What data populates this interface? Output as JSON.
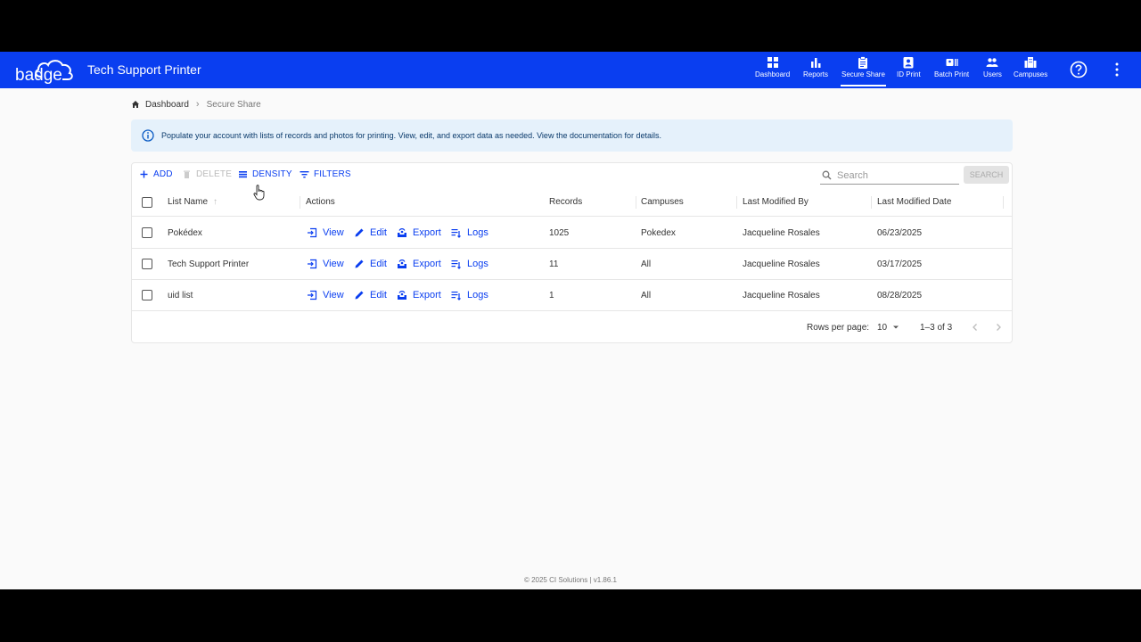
{
  "appbar": {
    "logo_text": "badge",
    "title": "Tech Support Printer",
    "nav": [
      {
        "label": "Dashboard",
        "icon": "dashboard-icon"
      },
      {
        "label": "Reports",
        "icon": "bar-chart-icon"
      },
      {
        "label": "Secure Share",
        "icon": "clipboard-icon",
        "active": true
      },
      {
        "label": "ID Print",
        "icon": "id-badge-icon"
      },
      {
        "label": "Batch Print",
        "icon": "batch-print-icon"
      },
      {
        "label": "Users",
        "icon": "users-icon"
      },
      {
        "label": "Campuses",
        "icon": "building-icon"
      }
    ]
  },
  "breadcrumb": {
    "home": "Dashboard",
    "current": "Secure Share"
  },
  "info": {
    "text": "Populate your account with lists of records and photos for printing. View, edit, and export data as needed. View the documentation for details."
  },
  "toolbar": {
    "add": "ADD",
    "delete": "DELETE",
    "density": "DENSITY",
    "filters": "FILTERS",
    "search_placeholder": "Search",
    "search_button": "SEARCH"
  },
  "table": {
    "columns": [
      "List Name",
      "Actions",
      "Records",
      "Campuses",
      "Last Modified By",
      "Last Modified Date"
    ],
    "actions": [
      "View",
      "Edit",
      "Export",
      "Logs"
    ],
    "rows": [
      {
        "name": "Pokédex",
        "records": "1025",
        "campuses": "Pokedex",
        "modified_by": "Jacqueline Rosales",
        "modified_date": "06/23/2025"
      },
      {
        "name": "Tech Support Printer",
        "records": "11",
        "campuses": "All",
        "modified_by": "Jacqueline Rosales",
        "modified_date": "03/17/2025"
      },
      {
        "name": "uid list",
        "records": "1",
        "campuses": "All",
        "modified_by": "Jacqueline Rosales",
        "modified_date": "08/28/2025"
      }
    ]
  },
  "pagination": {
    "rows_per_page_label": "Rows per page:",
    "rows_per_page_value": "10",
    "range": "1–3 of 3"
  },
  "footer": {
    "copyright": "© 2025 CI Solutions | v1.86.1"
  },
  "colors": {
    "primary": "#0a3ef0",
    "info_bg": "#e5f1fb"
  }
}
